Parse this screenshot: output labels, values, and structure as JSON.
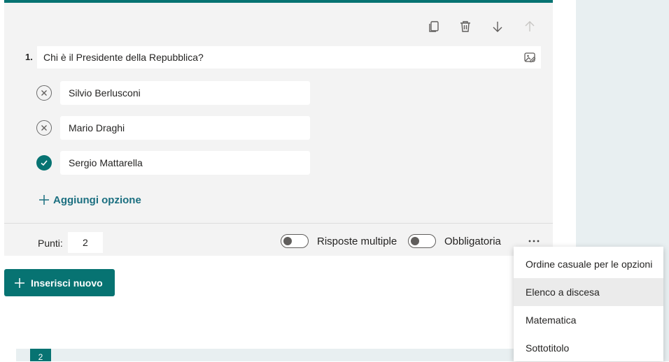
{
  "question": {
    "number": "1.",
    "text": "Chi è il Presidente della Repubblica?",
    "options": [
      {
        "label": "Silvio Berlusconi",
        "correct": false
      },
      {
        "label": "Mario Draghi",
        "correct": false
      },
      {
        "label": "Sergio Mattarella",
        "correct": true
      }
    ],
    "add_option_label": "Aggiungi opzione"
  },
  "footer": {
    "points_label": "Punti:",
    "points_value": "2",
    "multiple_answers_label": "Risposte multiple",
    "multiple_answers_on": false,
    "required_label": "Obbligatoria",
    "required_on": false
  },
  "insert_new_label": "Inserisci nuovo",
  "next_question_number": "2",
  "more_menu": {
    "items": [
      "Ordine casuale per le opzioni",
      "Elenco a discesa",
      "Matematica",
      "Sottotitolo"
    ],
    "hovered_index": 1
  },
  "colors": {
    "accent": "#077372",
    "link": "#1b6f80",
    "card_bg": "#f3f3f3",
    "side_bg": "#e8eff1"
  }
}
